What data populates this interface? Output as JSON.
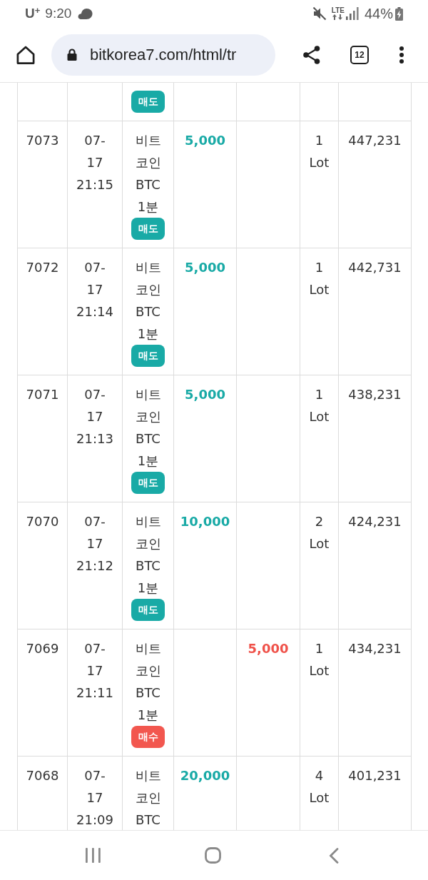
{
  "status_bar": {
    "carrier": "U$^{+}$",
    "time": "9:20",
    "network": "LTE",
    "battery": "44%"
  },
  "browser_toolbar": {
    "url": "bitkorea7.com/html/tr",
    "tab_count": "12"
  },
  "table": {
    "rows": [
      {
        "badge": {
          "kind": "sell",
          "label": "매도"
        }
      },
      {
        "column_1": "7073",
        "column_2": [
          "07-",
          "17",
          "21:15"
        ],
        "column_3": [
          "비트",
          "코인",
          "BTC",
          "1분"
        ],
        "badge": {
          "kind": "sell",
          "label": "매도"
        },
        "column_4": "5,000",
        "column_6": [
          "1",
          "Lot"
        ],
        "column_7": "447,231"
      },
      {
        "column_1": "7072",
        "column_2": [
          "07-",
          "17",
          "21:14"
        ],
        "column_3": [
          "비트",
          "코인",
          "BTC",
          "1분"
        ],
        "badge": {
          "kind": "sell",
          "label": "매도"
        },
        "column_4": "5,000",
        "column_6": [
          "1",
          "Lot"
        ],
        "column_7": "442,731"
      },
      {
        "column_1": "7071",
        "column_2": [
          "07-",
          "17",
          "21:13"
        ],
        "column_3": [
          "비트",
          "코인",
          "BTC",
          "1분"
        ],
        "badge": {
          "kind": "sell",
          "label": "매도"
        },
        "column_4": "5,000",
        "column_6": [
          "1",
          "Lot"
        ],
        "column_7": "438,231"
      },
      {
        "column_1": "7070",
        "column_2": [
          "07-",
          "17",
          "21:12"
        ],
        "column_3": [
          "비트",
          "코인",
          "BTC",
          "1분"
        ],
        "badge": {
          "kind": "sell",
          "label": "매도"
        },
        "column_4": "10,000",
        "column_6": [
          "2",
          "Lot"
        ],
        "column_7": "424,231"
      },
      {
        "column_1": "7069",
        "column_2": [
          "07-",
          "17",
          "21:11"
        ],
        "column_3": [
          "비트",
          "코인",
          "BTC",
          "1분"
        ],
        "badge": {
          "kind": "buy",
          "label": "매수"
        },
        "column_5": "5,000",
        "column_6": [
          "1",
          "Lot"
        ],
        "column_7": "434,231"
      },
      {
        "column_1": "7068",
        "column_2": [
          "07-",
          "17",
          "21:09"
        ],
        "column_3": [
          "비트",
          "코인",
          "BTC"
        ],
        "column_4": "20,000",
        "column_6": [
          "4",
          "Lot"
        ],
        "column_7": "401,231"
      }
    ]
  }
}
